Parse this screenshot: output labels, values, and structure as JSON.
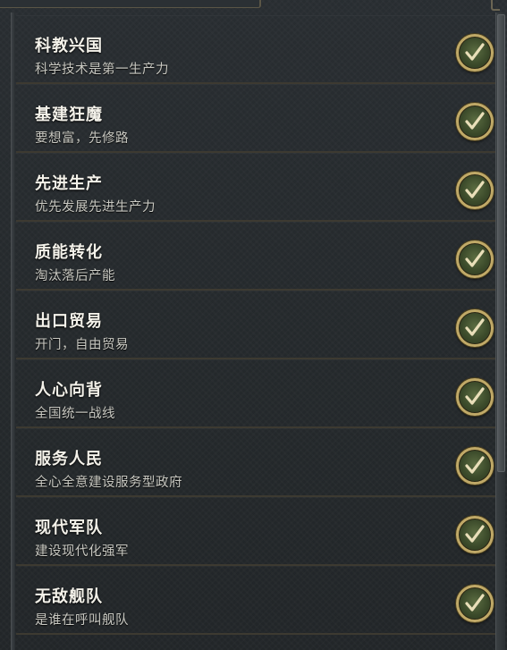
{
  "policies": [
    {
      "title": "科教兴国",
      "subtitle": "科学技术是第一生产力",
      "icon": "checkmark-icon"
    },
    {
      "title": "基建狂魔",
      "subtitle": "要想富，先修路",
      "icon": "checkmark-icon"
    },
    {
      "title": "先进生产",
      "subtitle": "优先发展先进生产力",
      "icon": "checkmark-icon"
    },
    {
      "title": "质能转化",
      "subtitle": "淘汰落后产能",
      "icon": "checkmark-icon"
    },
    {
      "title": "出口贸易",
      "subtitle": "开门，自由贸易",
      "icon": "checkmark-icon"
    },
    {
      "title": "人心向背",
      "subtitle": "全国统一战线",
      "icon": "checkmark-icon"
    },
    {
      "title": "服务人民",
      "subtitle": "全心全意建设服务型政府",
      "icon": "checkmark-icon"
    },
    {
      "title": "现代军队",
      "subtitle": "建设现代化强军",
      "icon": "checkmark-icon"
    },
    {
      "title": "无敌舰队",
      "subtitle": "是谁在呼叫舰队",
      "icon": "checkmark-icon"
    }
  ],
  "colors": {
    "check_ring": "#c0a967",
    "check_fill": "#3b4a2a",
    "divider": "#3d3a31"
  }
}
